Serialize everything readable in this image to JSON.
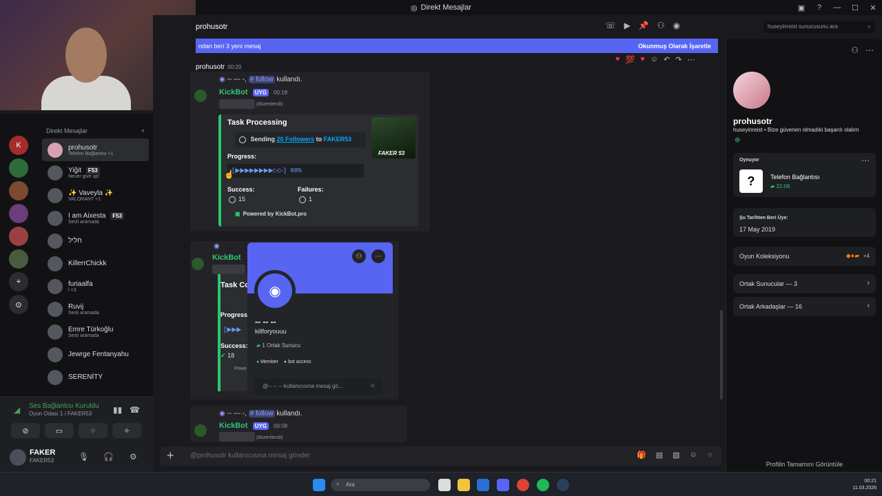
{
  "window": {
    "title": "Direkt Mesajlar"
  },
  "channel": {
    "name": "prohusotr"
  },
  "search": {
    "placeholder": "huseyinreist sunucusunu ara"
  },
  "banner": {
    "new_text": "ndan beri 3 yeni mesaj",
    "mark_read": "Okunmuş Olarak İşaretle"
  },
  "sidebar": {
    "header": "Direkt Mesajlar",
    "items": [
      {
        "name": "prohusotr",
        "sub": "Telefon Bağlantısı +1"
      },
      {
        "name": "Yiğit",
        "tag": "F53",
        "sub": "Never give up!"
      },
      {
        "name": "✨ Vaveyla ✨",
        "sub": "VALORANT +1"
      },
      {
        "name": "I am Aixesta",
        "tag": "F53",
        "sub": "Sesli aramada"
      },
      {
        "name": "חליל",
        "sub": ""
      },
      {
        "name": "KillerrChickk",
        "sub": ""
      },
      {
        "name": "furiaalfa",
        "sub": "l <3"
      },
      {
        "name": "Ruvij",
        "sub": "Sesli aramada"
      },
      {
        "name": "Emre Türkoğlu",
        "sub": "Sesli aramada"
      },
      {
        "name": "Jewrge Fentanyahu",
        "sub": ""
      },
      {
        "name": "SERENİTY",
        "sub": ""
      }
    ]
  },
  "voice": {
    "status": "Ses Bağlantısı Kuruldu",
    "channel": "Oyun Odası 1 / FAKER53"
  },
  "user": {
    "name": "FAKER",
    "handle": "FAKER53"
  },
  "messages": {
    "first": {
      "author": "prohusotr",
      "time": "00:20",
      "ref_dashes": "-- --- -",
      "command": "follow",
      "used": "kullandı.",
      "bot": "KickBot",
      "badge": "UYG",
      "bot_time": "00:18",
      "edited": "(düzenlendi)",
      "embed": {
        "title": "Task Processing",
        "task_prefix": "Sending",
        "followers": "20 Followers",
        "to": "to",
        "target": "FAKER53",
        "progress_label": "Progress:",
        "progress_bar": "[▶▶▶▶▶▶▶▶▷▷]  80%",
        "progress_value": 80,
        "success_label": "Success:",
        "success_value": "15",
        "failures_label": "Failures:",
        "failures_value": "1",
        "thumb_text": "FAKER 53",
        "footer": "Powered by KickBot.pro"
      }
    },
    "second": {
      "bot": "KickBot",
      "task": "Task Co",
      "progress": "Progress:",
      "bar": "[▶▶▶",
      "success": "Success:",
      "success_value": "18",
      "footer": "Powe"
    },
    "third": {
      "ref_dashes": "-- --- -",
      "command": "follow",
      "used": "kullandı.",
      "bot": "KickBot",
      "badge": "UYG",
      "bot_time": "00:08",
      "edited": "(düzenlendi)"
    }
  },
  "popup": {
    "name": "-- -- --",
    "handle": "killforyouuu",
    "mutual": "1 Ortak Sunucu",
    "role1": "Member",
    "role2": "bot access",
    "input_placeholder": "@-- -- -- kullanıcısına mesaj gö..."
  },
  "composer": {
    "placeholder": "@prohusotr kullanıcısına mesaj gönder"
  },
  "profile": {
    "name": "prohusotr",
    "status": "huseyinreist • Bize güvenen olmadıki başarılı olalım",
    "playing_caption": "Oynuyor",
    "activity": "Telefon Bağlantısı",
    "activity_time": "31:06",
    "member_since_caption": "Şu Tarihten Beri Üye:",
    "member_since": "17 May 2019",
    "game_collection": "Oyun Koleksiyonu",
    "game_more": "+4",
    "mutual_servers": "Ortak Sunucular — 3",
    "mutual_friends": "Ortak Arkadaşlar — 16",
    "view_full": "Profilin Tamamını Görüntüle"
  },
  "taskbar": {
    "search": "Ara",
    "time": "00:21",
    "date": "11.03.2026"
  },
  "colors": {
    "accent": "#5865f2",
    "bot_green": "#2dc770",
    "link": "#00a8fc"
  }
}
